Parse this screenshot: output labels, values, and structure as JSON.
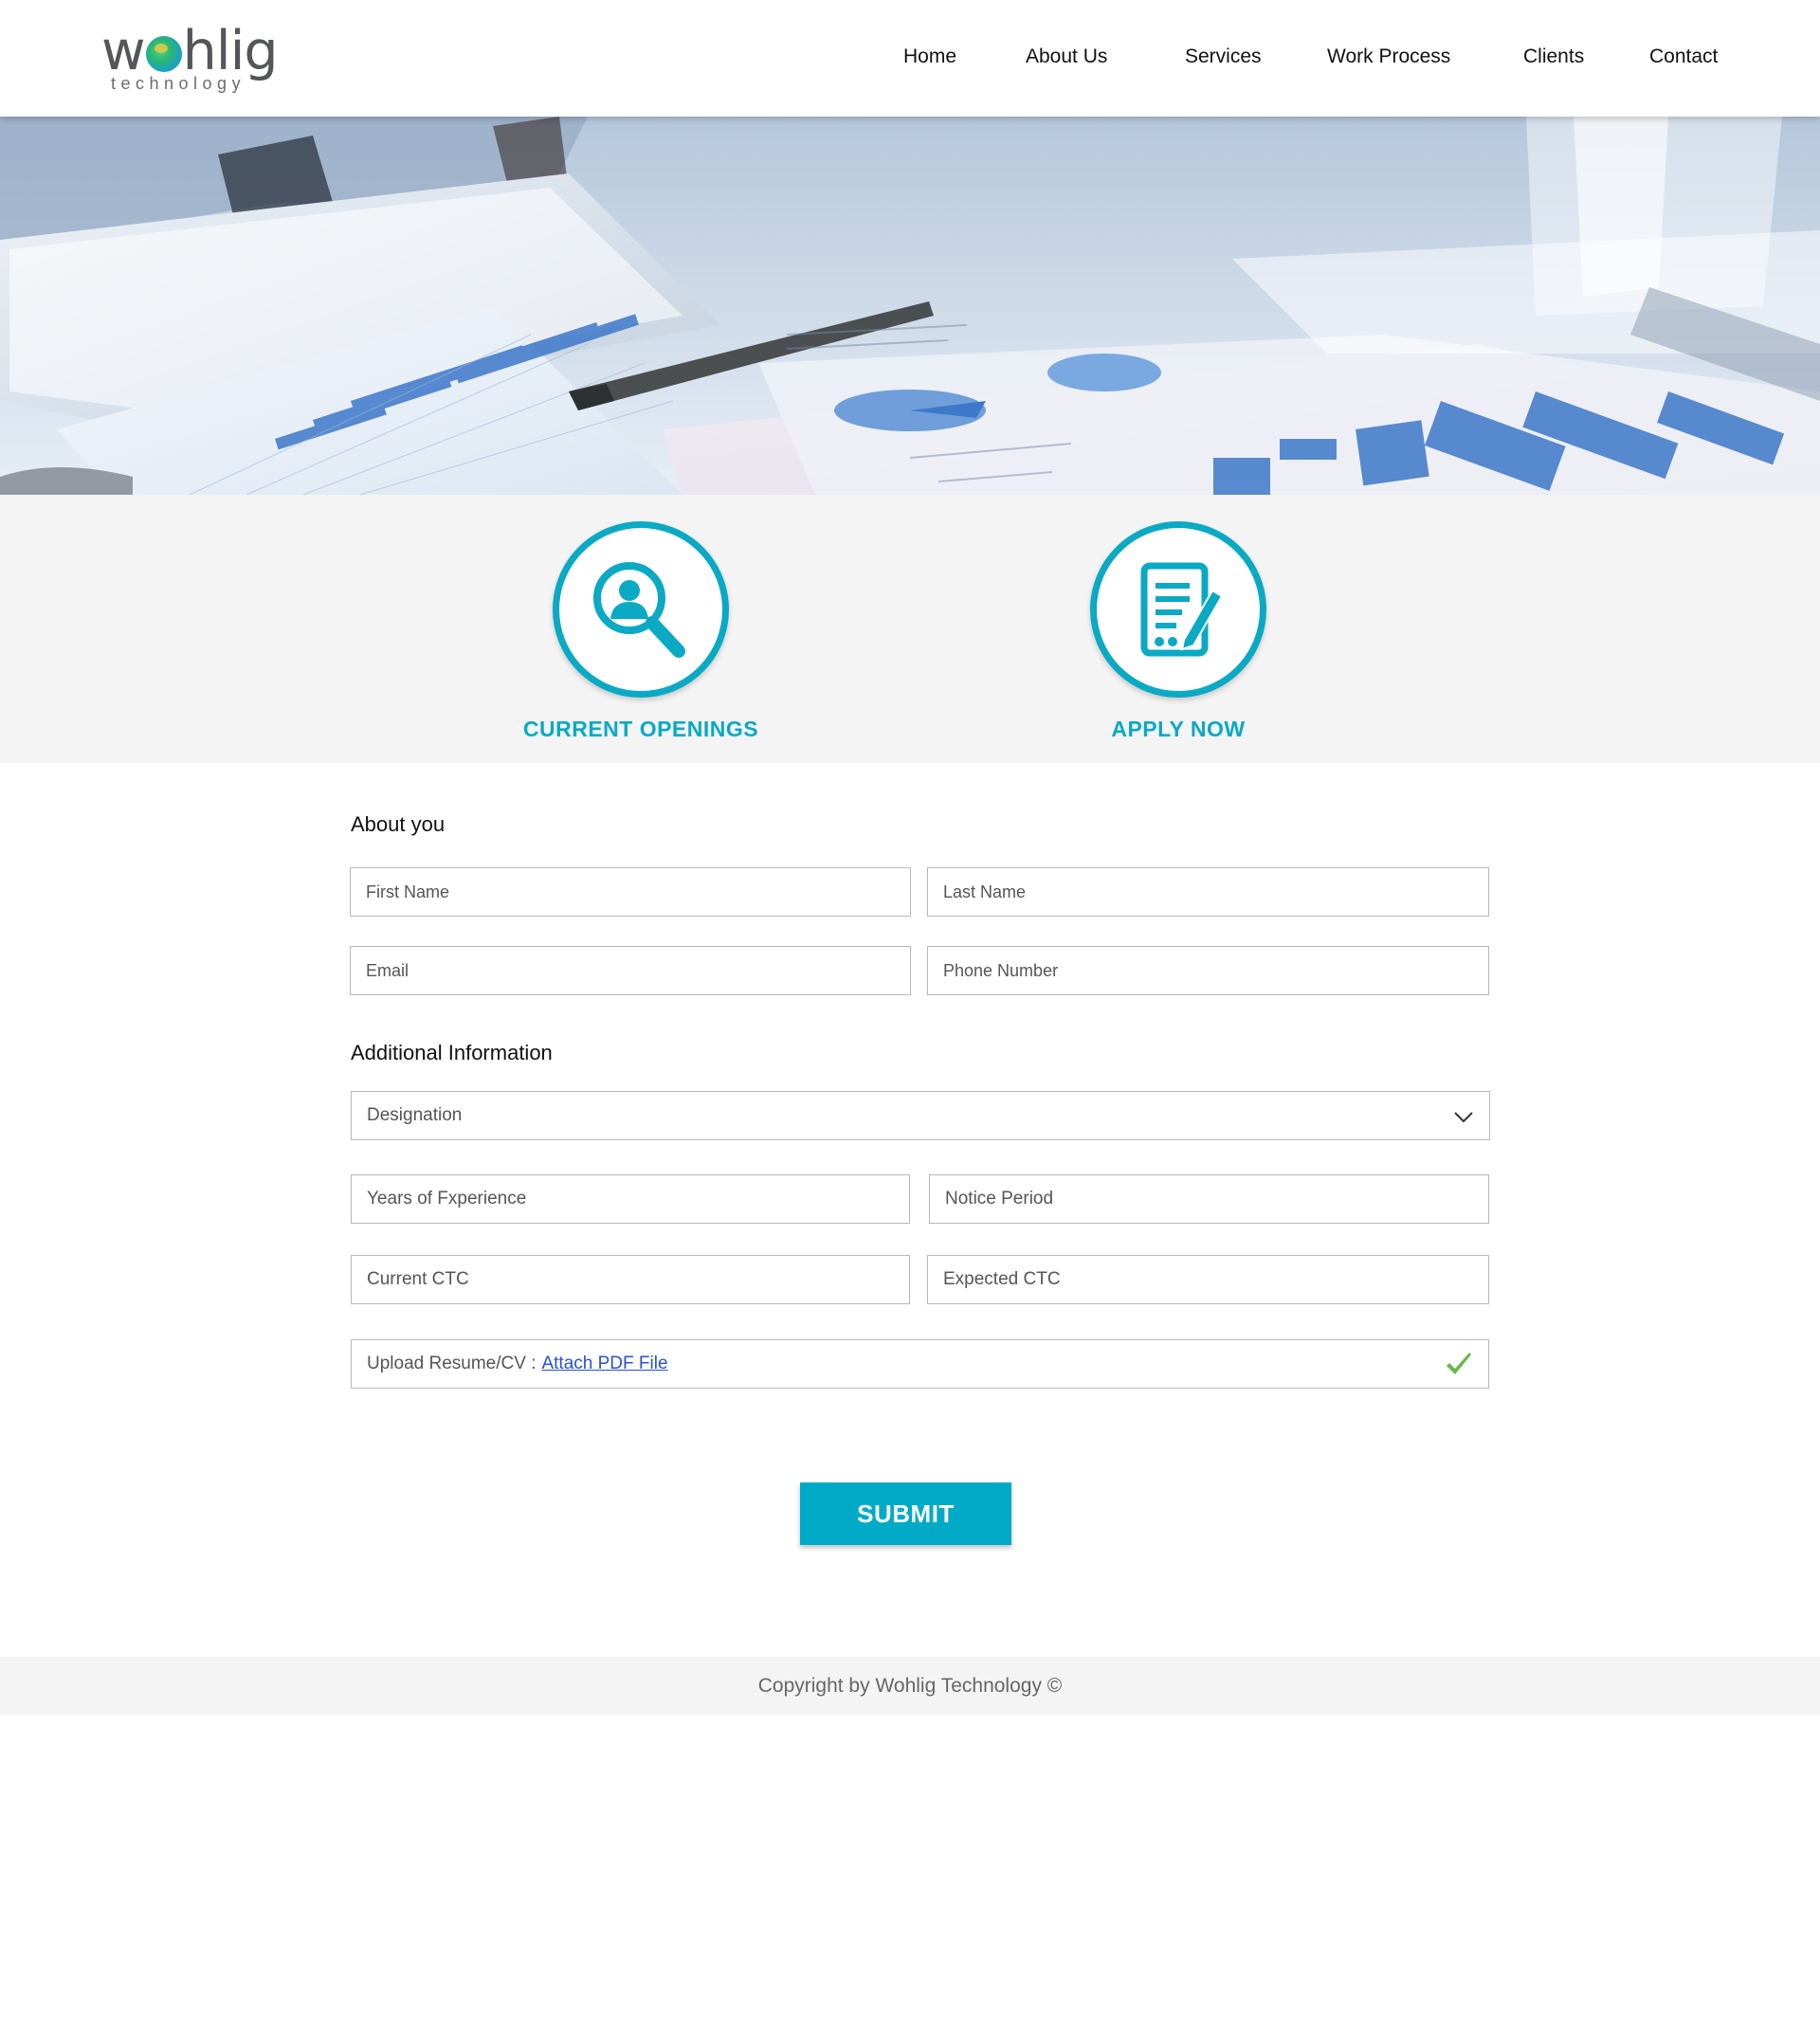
{
  "brand": {
    "logo_text": "wohlig",
    "logo_sub": "technology"
  },
  "nav": {
    "items": [
      "Home",
      "About Us",
      "Services",
      "Work Process",
      "Clients",
      "Contact"
    ]
  },
  "features": {
    "openings_label": "CURRENT OPENINGS",
    "apply_label": "APPLY NOW",
    "accent": "#0aa9c4"
  },
  "form": {
    "about_title": "About you",
    "first_name_placeholder": "First Name",
    "last_name_placeholder": "Last Name",
    "email_placeholder": "Email",
    "phone_placeholder": "Phone Number",
    "additional_title": "Additional Information",
    "designation_placeholder": "Designation",
    "experience_placeholder": "Years of Fxperience",
    "notice_placeholder": "Notice Period",
    "current_ctc_placeholder": "Current CTC",
    "expected_ctc_placeholder": "Expected CTC",
    "upload_label": "Upload Resume/CV :",
    "upload_link": "Attach PDF File",
    "upload_status_icon": "check-icon",
    "submit_label": "SUBMIT",
    "submit_color": "#00aac6"
  },
  "footer": {
    "copyright": "Copyright by Wohlig Technology ©"
  }
}
